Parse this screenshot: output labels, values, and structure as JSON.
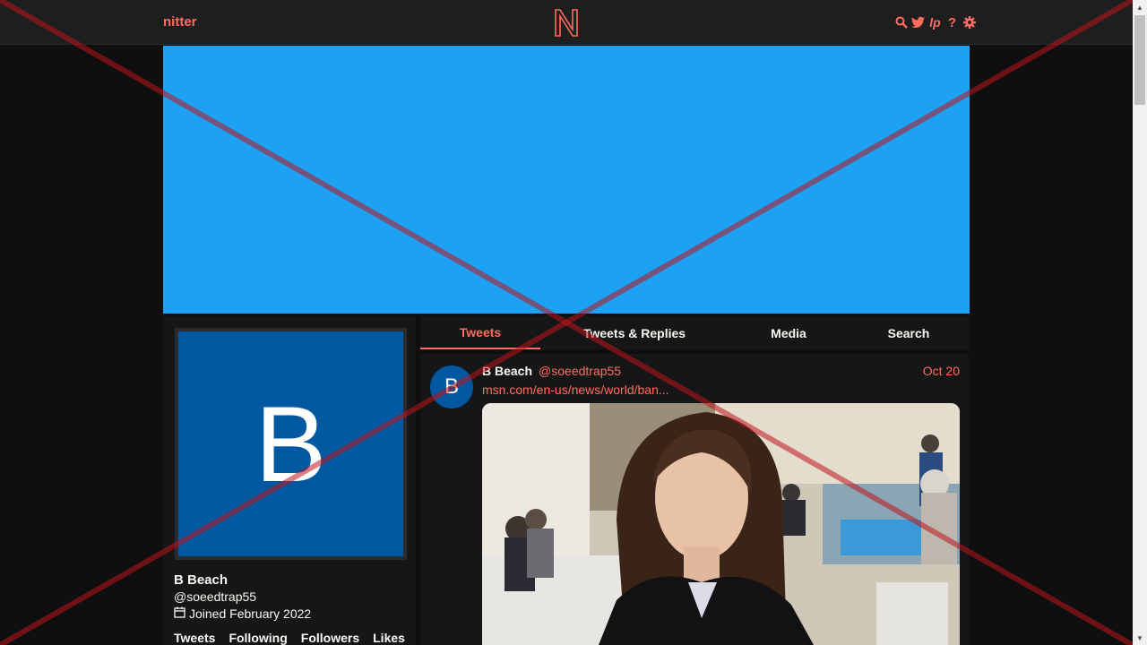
{
  "navbar": {
    "brand": "nitter",
    "logo_letter": "N",
    "icons": [
      "search-icon",
      "twitter-bird-icon",
      "lp-icon",
      "help-icon",
      "gear-icon"
    ],
    "lp_text": "lp",
    "help_text": "?"
  },
  "colors": {
    "accent": "#ff6c60",
    "banner": "#1da1f2",
    "avatar": "#0058a0",
    "background": "#0f0f0f",
    "panel": "#161616",
    "navbar": "#1e1e1e"
  },
  "profile": {
    "avatar_letter": "B",
    "fullname": "B Beach",
    "username": "@soeedtrap55",
    "joined": "Joined February 2022",
    "stats": [
      "Tweets",
      "Following",
      "Followers",
      "Likes"
    ]
  },
  "tabs": [
    {
      "label": "Tweets",
      "active": true
    },
    {
      "label": "Tweets & Replies",
      "active": false
    },
    {
      "label": "Media",
      "active": false
    },
    {
      "label": "Search",
      "active": false
    }
  ],
  "tweet": {
    "avatar_letter": "B",
    "fullname": "B Beach",
    "username": "@soeedtrap55",
    "date": "Oct 20",
    "link": "msn.com/en-us/news/world/ban..."
  }
}
